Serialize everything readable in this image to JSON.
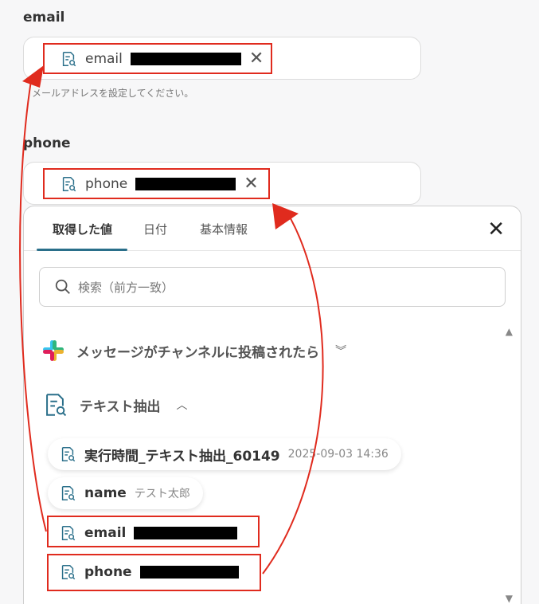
{
  "email_field": {
    "label": "email",
    "chip_label": "email",
    "helper": "メールアドレスを設定してください。"
  },
  "phone_field": {
    "label": "phone",
    "chip_label": "phone"
  },
  "picker": {
    "tabs": [
      "取得した値",
      "日付",
      "基本情報"
    ],
    "search_placeholder": "検索（前方一致）",
    "sections": [
      {
        "title": "メッセージがチャンネルに投稿されたら",
        "state": "collapsed"
      },
      {
        "title": "テキスト抽出",
        "state": "expanded"
      }
    ],
    "items": [
      {
        "name": "実行時間_テキスト抽出_60149",
        "value": "2025-09-03 14:36"
      },
      {
        "name": "name",
        "value": "テスト太郎"
      },
      {
        "name": "email",
        "value": ""
      },
      {
        "name": "phone",
        "value": ""
      }
    ]
  },
  "colors": {
    "accent": "#2a6f8a",
    "annotation": "#e02b1e"
  }
}
